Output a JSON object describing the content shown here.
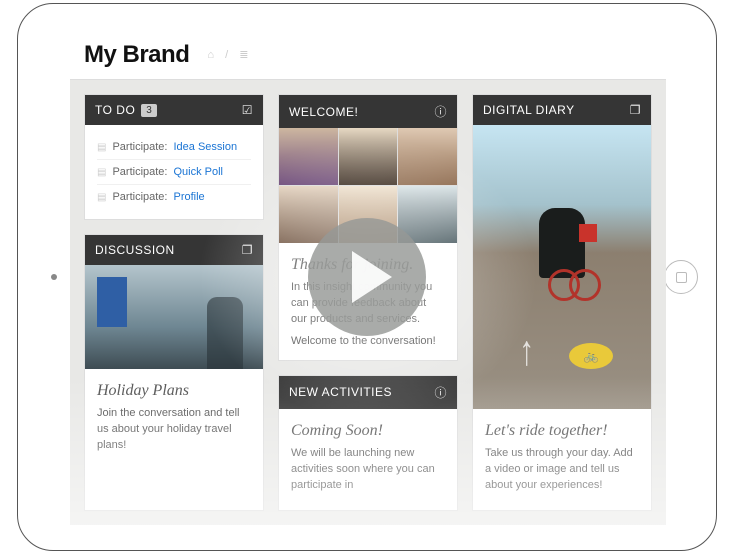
{
  "brand": "My Brand",
  "breadcrumb": {
    "home_icon": "⌂",
    "sep": "/",
    "stats_icon": "≣"
  },
  "todo": {
    "title": "TO DO",
    "count": "3",
    "items": [
      {
        "prefix": "Participate:",
        "link": "Idea Session"
      },
      {
        "prefix": "Participate:",
        "link": "Quick Poll"
      },
      {
        "prefix": "Participate:",
        "link": "Profile"
      }
    ]
  },
  "discussion": {
    "header": "DISCUSSION",
    "title": "Holiday Plans",
    "body": "Join the conversation and tell us about your holiday travel plans!"
  },
  "welcome": {
    "header": "WELCOME!",
    "title": "Thanks for joining.",
    "body1": "In this insight community you can provide feedback about our products and services.",
    "body2": "Welcome to the conversation!"
  },
  "activities": {
    "header": "NEW ACTIVITIES",
    "title": "Coming Soon!",
    "body": "We will be launching new activities soon where you can participate in"
  },
  "diary": {
    "header": "DIGITAL DIARY",
    "title": "Let's ride together!",
    "body": "Take us through your day. Add a video or image and tell us about your experiences!"
  },
  "icons": {
    "check": "☑",
    "info": "ⓘ",
    "speech": "❐",
    "chat": "▤",
    "bike": "🚲"
  }
}
